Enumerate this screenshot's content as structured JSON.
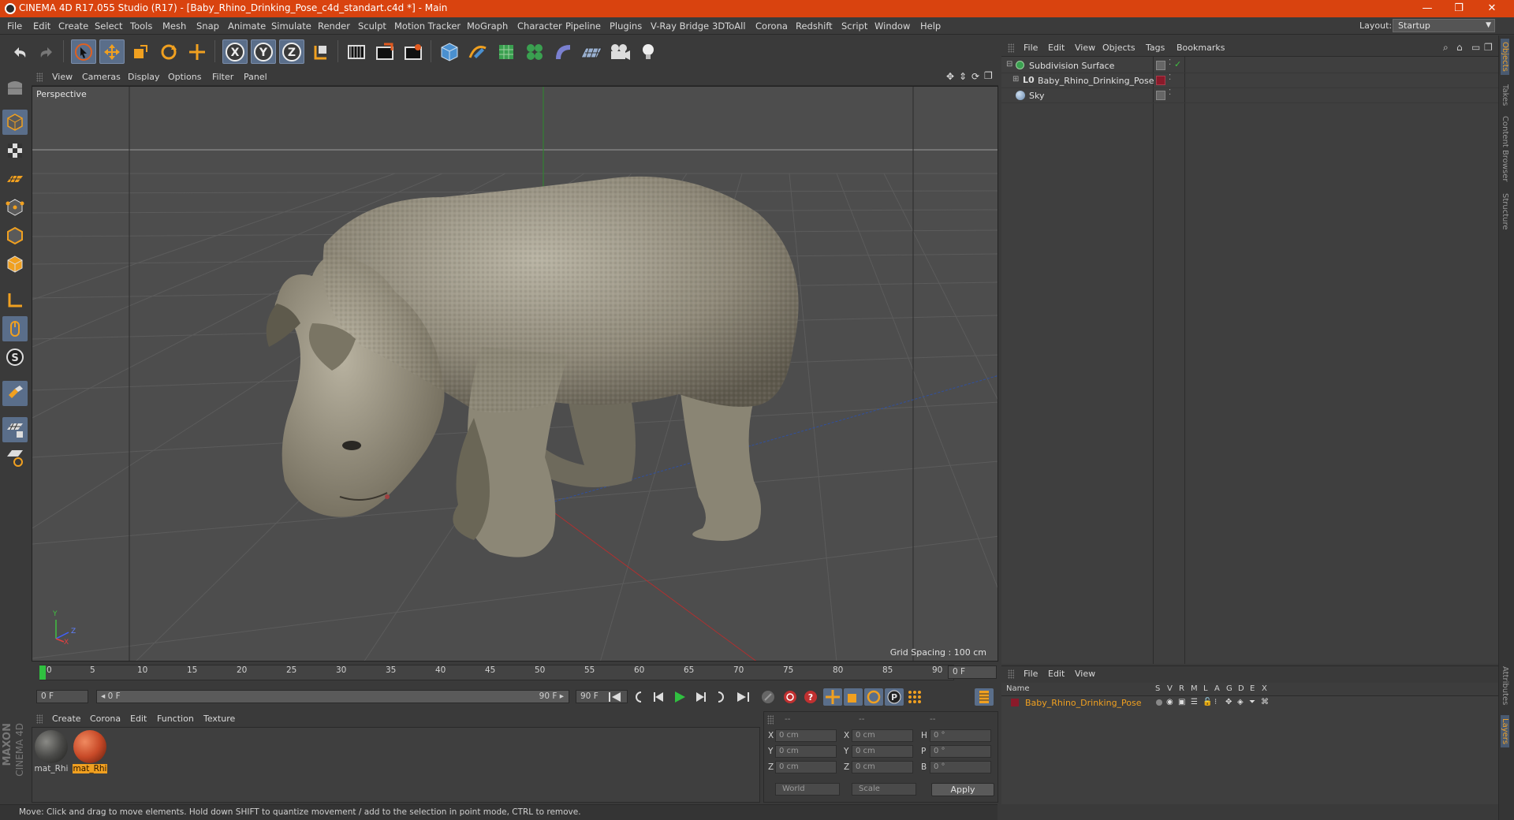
{
  "window": {
    "title": "CINEMA 4D R17.055 Studio (R17) - [Baby_Rhino_Drinking_Pose_c4d_standart.c4d *] - Main",
    "controls": [
      "—",
      "❐",
      "✕"
    ]
  },
  "menubar": {
    "items": [
      "File",
      "Edit",
      "Create",
      "Select",
      "Tools",
      "Mesh",
      "Snap",
      "Animate",
      "Simulate",
      "Render",
      "Sculpt",
      "Motion Tracker",
      "MoGraph",
      "Character",
      "Pipeline",
      "Plugins",
      "V-Ray Bridge",
      "3DToAll",
      "Corona",
      "Redshift",
      "Script",
      "Window",
      "Help"
    ],
    "layout_label": "Layout:",
    "layout_value": "Startup"
  },
  "toolbar": {
    "icons": [
      "undo-icon",
      "redo-icon",
      "select-cursor-icon",
      "move-icon",
      "scale-icon",
      "rotate-icon",
      "live-select-icon",
      "x-axis-icon",
      "y-axis-icon",
      "z-axis-icon",
      "coordinate-system-icon",
      "render-view-icon",
      "render-active-icon",
      "render-settings-icon",
      "cube-primitive-icon",
      "pen-spline-icon",
      "subdivision-icon",
      "cloner-icon",
      "deformer-icon",
      "floor-icon",
      "camera-icon",
      "light-icon"
    ]
  },
  "viewport": {
    "menu": [
      "View",
      "Cameras",
      "Display",
      "Options",
      "Filter",
      "Panel"
    ],
    "label": "Perspective",
    "grid_spacing": "Grid Spacing : 100 cm",
    "axis_labels": [
      "Y",
      "Z",
      "X"
    ]
  },
  "timeline": {
    "ticks": [
      "0",
      "5",
      "10",
      "15",
      "20",
      "25",
      "30",
      "35",
      "40",
      "45",
      "50",
      "55",
      "60",
      "65",
      "70",
      "75",
      "80",
      "85",
      "90"
    ],
    "current_frame": "0 F",
    "start_field": "0 F",
    "range_start": "◂ 0 F",
    "range_end": "90 F ▸",
    "end_field": "90 F"
  },
  "material_manager": {
    "menu": [
      "Create",
      "Corona",
      "Edit",
      "Function",
      "Texture"
    ],
    "materials": [
      {
        "name": "mat_Rhi",
        "selected": false,
        "color": "#4a4a48"
      },
      {
        "name": "mat_Rhi",
        "selected": true,
        "color": "#c84a28"
      }
    ]
  },
  "coordinates": {
    "header": [
      "--",
      "--",
      "--"
    ],
    "rows": [
      {
        "a": "X",
        "v1": "0 cm",
        "b": "X",
        "v2": "0 cm",
        "c": "H",
        "v3": "0 °"
      },
      {
        "a": "Y",
        "v1": "0 cm",
        "b": "Y",
        "v2": "0 cm",
        "c": "P",
        "v3": "0 °"
      },
      {
        "a": "Z",
        "v1": "0 cm",
        "b": "Z",
        "v2": "0 cm",
        "c": "B",
        "v3": "0 °"
      }
    ],
    "space": "World",
    "mode": "Scale",
    "apply": "Apply"
  },
  "object_manager": {
    "menu": [
      "File",
      "Edit",
      "View",
      "Objects",
      "Tags",
      "Bookmarks"
    ],
    "objects": [
      {
        "name": "Subdivision Surface",
        "indent": 0
      },
      {
        "name": "Baby_Rhino_Drinking_Pose",
        "indent": 1
      },
      {
        "name": "Sky",
        "indent": 0
      }
    ]
  },
  "layer_manager": {
    "menu": [
      "File",
      "Edit",
      "View"
    ],
    "columns": [
      "Name",
      "S",
      "V",
      "R",
      "M",
      "L",
      "A",
      "G",
      "D",
      "E",
      "X"
    ],
    "layers": [
      {
        "name": "Baby_Rhino_Drinking_Pose",
        "color": "#8a1a2a"
      }
    ]
  },
  "right_tabs": [
    "Objects",
    "Takes",
    "Content Browser",
    "Structure",
    "Attributes",
    "Layers"
  ],
  "status": "Move: Click and drag to move elements. Hold down SHIFT to quantize movement / add to the selection in point mode, CTRL to remove.",
  "brand": [
    "MAXON",
    "CINEMA 4D"
  ],
  "colors": {
    "accent": "#d9430f",
    "selection": "#5a6e8a",
    "material_selected": "#f0a020"
  }
}
